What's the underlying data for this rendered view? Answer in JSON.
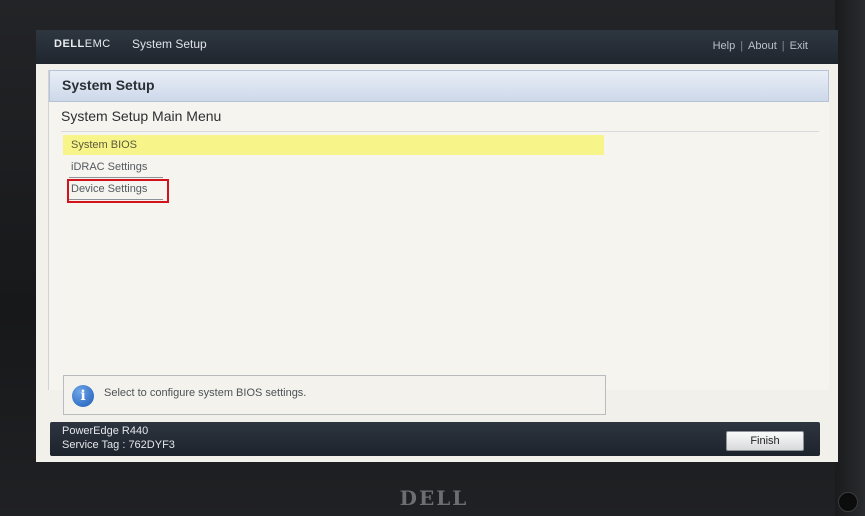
{
  "topbar": {
    "brand_dell": "DELL",
    "brand_emc": "EMC",
    "app_title": "System Setup",
    "links": [
      "Help",
      "About",
      "Exit"
    ]
  },
  "header": {
    "title": "System Setup"
  },
  "main": {
    "menu_title": "System Setup Main Menu",
    "items": [
      {
        "label": "System BIOS",
        "selected": true
      },
      {
        "label": "iDRAC Settings",
        "selected": false
      },
      {
        "label": "Device Settings",
        "selected": false,
        "annotated": true
      }
    ]
  },
  "help": {
    "icon": "info-icon",
    "text": "Select to configure system BIOS settings."
  },
  "footer": {
    "model": "PowerEdge R440",
    "service_tag": "Service Tag : 762DYF3",
    "finish_label": "Finish"
  },
  "monitor": {
    "logo": "DELL"
  },
  "colors": {
    "selected_bg": "#f7f48a",
    "annotation_red": "#d2131b",
    "bar_dark": "#1f262e",
    "header_blue": "#cdd8ea"
  }
}
